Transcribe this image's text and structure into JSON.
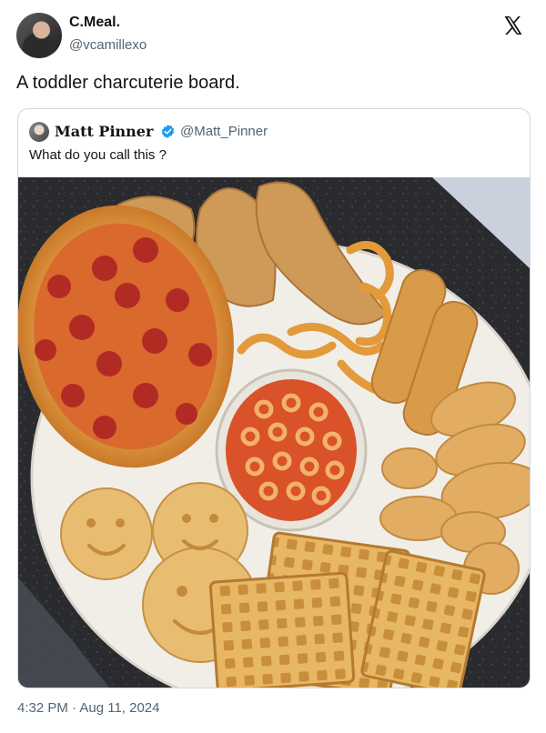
{
  "author": {
    "display_name": "C.Meal.",
    "handle": "@vcamillexo"
  },
  "tweet": {
    "text": "A toddler charcuterie board.",
    "timestamp": "4:32 PM · Aug 11, 2024"
  },
  "quoted_tweet": {
    "display_name": "Matt Pinner",
    "handle": "@Matt_Pinner",
    "text": "What do you call this ?",
    "verified": true
  },
  "icons": {
    "close": "x-logo-icon",
    "verified": "verified-badge-icon"
  },
  "colors": {
    "text": "#0f1419",
    "secondary": "#536471",
    "verified": "#1d9bf0",
    "border": "#cfd9de"
  }
}
